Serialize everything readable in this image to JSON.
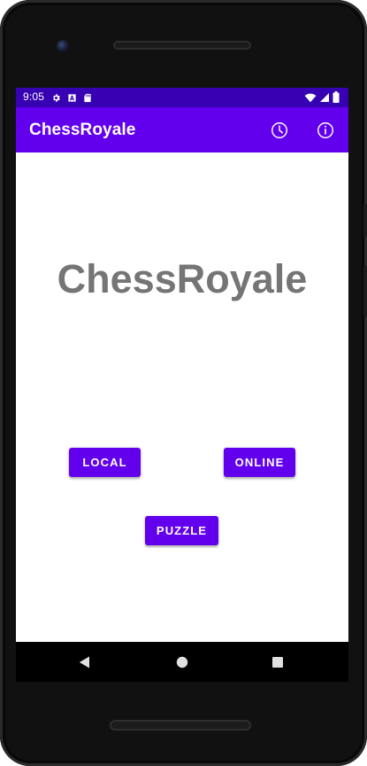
{
  "status_bar": {
    "time": "9:05",
    "left_icons": [
      "gear-icon",
      "text-icon",
      "sd-card-icon"
    ],
    "right_icons": [
      "wifi-icon",
      "cellular-icon",
      "battery-icon"
    ],
    "color": "#3700B3"
  },
  "app_bar": {
    "title": "ChessRoyale",
    "color": "#6200EE",
    "actions": [
      "clock-icon",
      "info-icon"
    ]
  },
  "main": {
    "title": "ChessRoyale",
    "title_color": "#757575"
  },
  "buttons": {
    "local": "LOCAL",
    "online": "ONLINE",
    "puzzle": "PUZZLE",
    "accent": "#6200EE"
  },
  "navigation": {
    "items": [
      "back-icon",
      "home-icon",
      "recent-apps-icon"
    ]
  }
}
